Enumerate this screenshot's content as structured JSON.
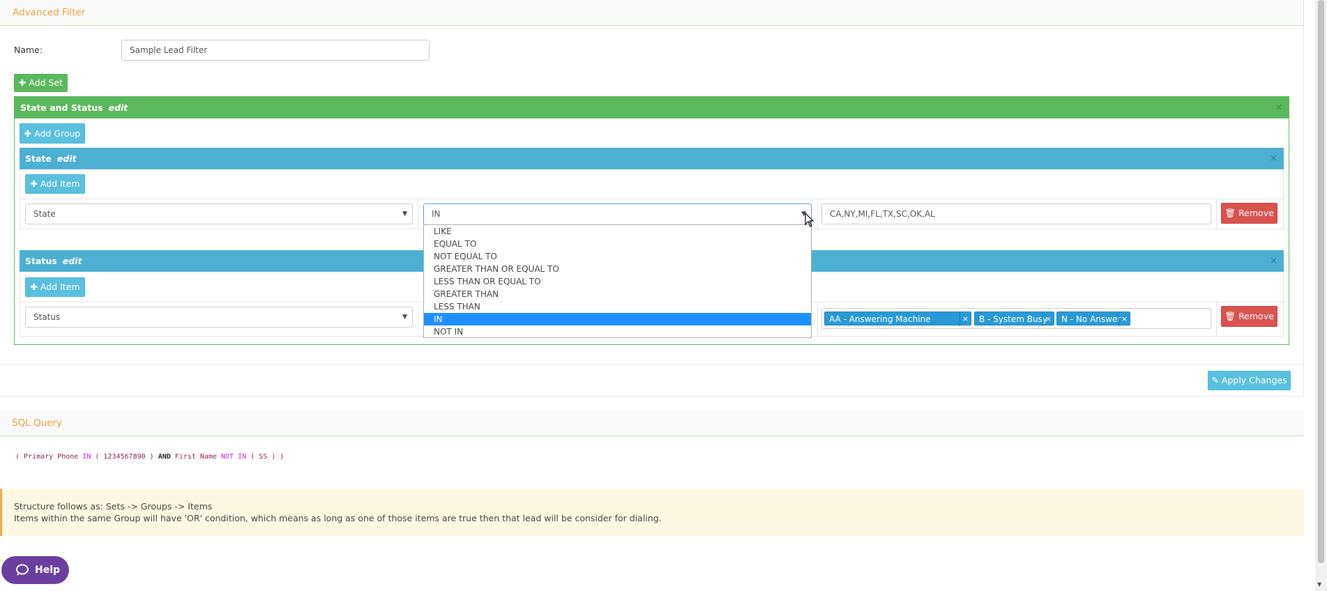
{
  "filter_panel": {
    "title": "Advanced Filter",
    "name_label": "Name:",
    "name_value": "Sample Lead Filter",
    "add_set_label": "Add Set",
    "apply_label": "Apply Changes"
  },
  "set": {
    "title": "State and Status",
    "edit_label": "edit",
    "add_group_label": "Add Group",
    "close_label": "×"
  },
  "groups": [
    {
      "title": "State",
      "edit_label": "edit",
      "close_label": "×",
      "add_item_label": "Add Item",
      "field": "State",
      "operator": "IN",
      "value": "CA,NY,MI,FL,TX,SC,OK,AL",
      "remove_label": "Remove"
    },
    {
      "title": "Status",
      "edit_label": "edit",
      "close_label": "×",
      "add_item_label": "Add Item",
      "field": "Status",
      "tags": [
        "AA - Answering Machine Detected",
        "B - System Busy",
        "N - No Answer"
      ],
      "tag_remove": "×",
      "remove_label": "Remove"
    }
  ],
  "operator_dropdown": {
    "options": [
      "LIKE",
      "EQUAL TO",
      "NOT EQUAL TO",
      "GREATER THAN OR EQUAL TO",
      "LESS THAN OR EQUAL TO",
      "GREATER THAN",
      "LESS THAN",
      "IN",
      "NOT IN"
    ],
    "selected": "IN"
  },
  "sql_panel": {
    "title": "SQL Query",
    "q1": "( Primary Phone ",
    "q2": "IN",
    "q3": " ( 1234567890 ) ",
    "q4": "AND",
    "q5": " First Name ",
    "q6": "NOT IN",
    "q7": " ( SS ) )"
  },
  "notice": {
    "line1": "Structure follows as: Sets -> Groups -> Items",
    "line2": "Items within the same Group will have 'OR' condition, which means as long as one of those items are true then that lead will be consider for dialing."
  },
  "help_button": {
    "label": "Help"
  },
  "icons": {
    "plus": "plus-icon",
    "trash": "trash-icon",
    "edit": "edit-icon",
    "chat": "chat-icon"
  }
}
